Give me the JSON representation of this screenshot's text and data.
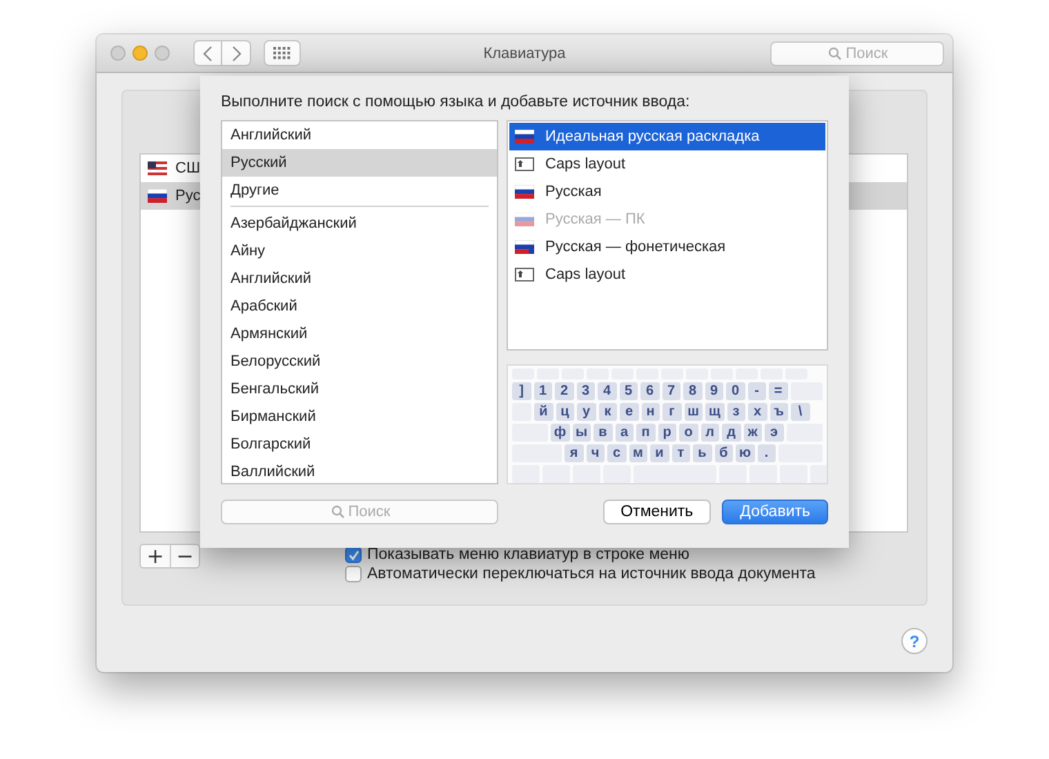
{
  "window": {
    "title": "Клавиатура",
    "search_placeholder": "Поиск"
  },
  "background_list": [
    {
      "label": "СШ",
      "kind": "us",
      "selected": false
    },
    {
      "label": "Рус",
      "kind": "ru",
      "selected": true
    }
  ],
  "options": [
    {
      "label": "Показывать меню клавиатур в строке меню",
      "checked": true
    },
    {
      "label": "Автоматически переключаться на источник ввода документа",
      "checked": false
    }
  ],
  "sheet": {
    "prompt": "Выполните поиск с помощью языка и добавьте источник ввода:",
    "languages_top": [
      {
        "label": "Английский",
        "selected": false
      },
      {
        "label": "Русский",
        "selected": true
      },
      {
        "label": "Другие",
        "selected": false
      }
    ],
    "languages": [
      {
        "label": "Азербайджанский",
        "selected": false
      },
      {
        "label": "Айну",
        "selected": false
      },
      {
        "label": "Английский",
        "selected": false
      },
      {
        "label": "Арабский",
        "selected": false
      },
      {
        "label": "Армянский",
        "selected": false
      },
      {
        "label": "Белорусский",
        "selected": false
      },
      {
        "label": "Бенгальский",
        "selected": false
      },
      {
        "label": "Бирманский",
        "selected": false
      },
      {
        "label": "Болгарский",
        "selected": false
      },
      {
        "label": "Валлийский",
        "selected": false
      }
    ],
    "sources": [
      {
        "label": "Идеальная русская раскладка",
        "kind": "flag",
        "selected": true,
        "disabled": false
      },
      {
        "label": "Caps layout",
        "kind": "caps",
        "selected": false,
        "disabled": false
      },
      {
        "label": "Русская",
        "kind": "flag",
        "selected": false,
        "disabled": false
      },
      {
        "label": "Русская — ПК",
        "kind": "flag",
        "selected": false,
        "disabled": true
      },
      {
        "label": "Русская — фонетическая",
        "kind": "phonetic",
        "selected": false,
        "disabled": false
      },
      {
        "label": "Caps layout",
        "kind": "caps",
        "selected": false,
        "disabled": false
      }
    ],
    "keyboard_rows": [
      [
        "]",
        "1",
        "2",
        "3",
        "4",
        "5",
        "6",
        "7",
        "8",
        "9",
        "0",
        "-",
        "="
      ],
      [
        "й",
        "ц",
        "у",
        "к",
        "е",
        "н",
        "г",
        "ш",
        "щ",
        "з",
        "х",
        "ъ",
        "\\"
      ],
      [
        "ф",
        "ы",
        "в",
        "а",
        "п",
        "р",
        "о",
        "л",
        "д",
        "ж",
        "э"
      ],
      [
        "я",
        "ч",
        "с",
        "м",
        "и",
        "т",
        "ь",
        "б",
        "ю",
        "."
      ]
    ],
    "search_placeholder": "Поиск",
    "cancel_button": "Отменить",
    "add_button": "Добавить"
  },
  "add_symbol": "+",
  "remove_symbol": "−",
  "help_symbol": "?"
}
